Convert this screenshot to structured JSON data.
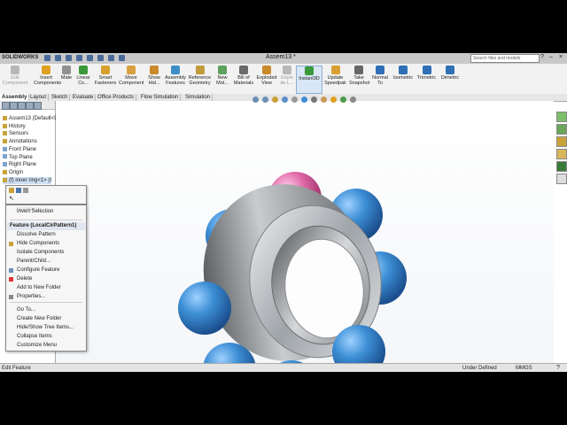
{
  "app": {
    "logo": "SOLIDWORKS",
    "doc_title": "Assem13 *"
  },
  "search": {
    "placeholder": "Search files and models"
  },
  "ribbon": [
    {
      "label": "Edit Component",
      "icon": "edit-component-icon",
      "color": "#b8b8b8",
      "dim": true
    },
    {
      "label": "Insert Components",
      "icon": "insert-components-icon",
      "color": "#e0a020"
    },
    {
      "label": "Mate",
      "icon": "mate-icon",
      "color": "#909090"
    },
    {
      "label": "Linear Co...",
      "icon": "linear-pattern-icon",
      "color": "#3a9a3a"
    },
    {
      "label": "Smart Fasteners",
      "icon": "smart-fasteners-icon",
      "color": "#d7a030"
    },
    {
      "label": "Move Component",
      "icon": "move-component-icon",
      "color": "#d8a040"
    },
    {
      "label": "Show Hid...",
      "icon": "show-hidden-icon",
      "color": "#c98a2a"
    },
    {
      "label": "Assembly Features",
      "icon": "assembly-features-icon",
      "color": "#3c8ec9"
    },
    {
      "label": "Reference Geometry",
      "icon": "reference-geometry-icon",
      "color": "#c29a3a"
    },
    {
      "label": "New Mot...",
      "icon": "new-motion-study-icon",
      "color": "#5ea05e"
    },
    {
      "label": "Bill of Materials",
      "icon": "bill-of-materials-icon",
      "color": "#6a6a6a"
    },
    {
      "label": "Exploded View",
      "icon": "exploded-view-icon",
      "color": "#c98a2a"
    },
    {
      "label": "Explo de L...",
      "icon": "explode-line-icon",
      "color": "#b8b8b8",
      "dim": true
    },
    {
      "label": "Instant3D",
      "icon": "instant3d-icon",
      "color": "#3a9a3a",
      "active": true
    },
    {
      "label": "Update Speedpak",
      "icon": "update-speedpak-icon",
      "color": "#d7a030"
    },
    {
      "label": "Take Snapshot",
      "icon": "take-snapshot-icon",
      "color": "#666"
    },
    {
      "label": "Normal To",
      "icon": "normal-to-icon",
      "color": "#2f6fb8"
    },
    {
      "label": "Isometric",
      "icon": "isometric-icon",
      "color": "#2f6fb8"
    },
    {
      "label": "Trimetric",
      "icon": "trimetric-icon",
      "color": "#2f6fb8"
    },
    {
      "label": "Dimetric",
      "icon": "dimetric-icon",
      "color": "#2f6fb8"
    }
  ],
  "tabs": [
    "Assembly",
    "Layout",
    "Sketch",
    "Evaluate",
    "Office Products",
    "Flow Simulation",
    "Simulation"
  ],
  "tree": [
    {
      "label": "Assem13  (Default<D",
      "type": "root"
    },
    {
      "label": "History",
      "type": "folder"
    },
    {
      "label": "Sensors",
      "type": "folder"
    },
    {
      "label": "Annotations",
      "type": "folder"
    },
    {
      "label": "Front Plane",
      "type": "plane"
    },
    {
      "label": "Top Plane",
      "type": "plane"
    },
    {
      "label": "Right Plane",
      "type": "plane"
    },
    {
      "label": "Origin",
      "type": "folder"
    },
    {
      "label": "(f) inner ring<1> (I",
      "type": "part"
    }
  ],
  "context_menu": {
    "ghost_1": "Normal To",
    "invert": "Invert Selection",
    "header": "Feature (LocalCirPattern1)",
    "items_a": [
      "Dissolve Pattern",
      "Hide Components",
      "Isolate Components",
      "Parent/Child...",
      "Configure Feature",
      "Delete",
      "Add to New Folder",
      "Properties..."
    ],
    "items_b": [
      "Go To...",
      "Create New Folder",
      "Hide/Show Tree Items...",
      "Collapse Items",
      "Customize Menu"
    ]
  },
  "status": {
    "left": "Edit Feature",
    "middle": "Under Defined",
    "units": "MMGS"
  },
  "colors": {
    "ball": "#3d8fd6",
    "ball_accent": "#e06aa8",
    "ring": "#b5b9bd"
  }
}
